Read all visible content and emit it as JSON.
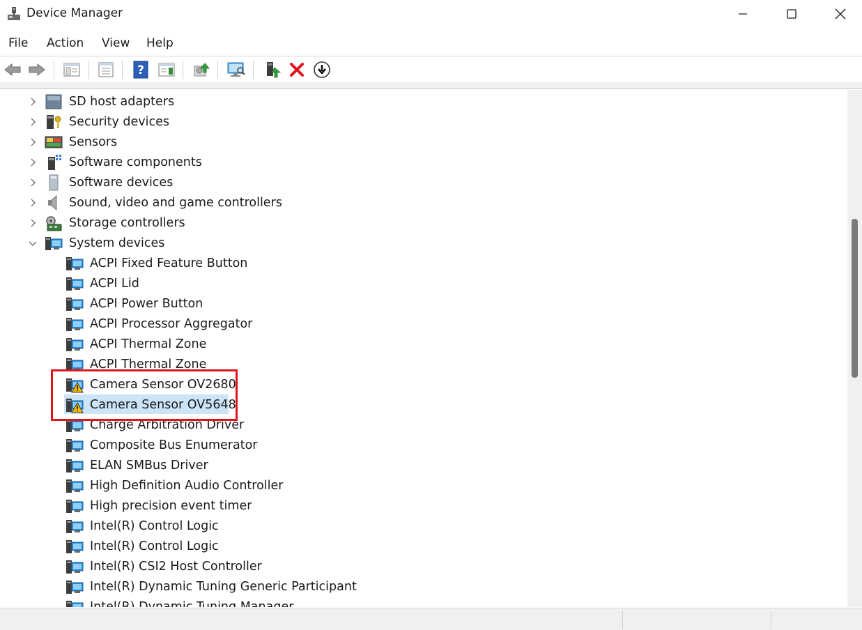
{
  "window": {
    "title": "Device Manager"
  },
  "menu": [
    "File",
    "Action",
    "View",
    "Help"
  ],
  "toolbar": {
    "buttons": [
      "back-icon",
      "forward-icon",
      "show-hide-console-tree-icon",
      "properties-icon",
      "help-icon",
      "action-pane-icon",
      "update-driver-icon",
      "scan-hardware-icon",
      "enable-device-icon",
      "uninstall-device-icon",
      "disable-device-icon"
    ]
  },
  "tree": {
    "categories": [
      {
        "label": "SD host adapters",
        "icon": "sd-host-icon",
        "expanded": false
      },
      {
        "label": "Security devices",
        "icon": "security-device-icon",
        "expanded": false
      },
      {
        "label": "Sensors",
        "icon": "sensor-icon",
        "expanded": false
      },
      {
        "label": "Software components",
        "icon": "software-component-icon",
        "expanded": false
      },
      {
        "label": "Software devices",
        "icon": "software-device-icon",
        "expanded": false
      },
      {
        "label": "Sound, video and game controllers",
        "icon": "speaker-icon",
        "expanded": false
      },
      {
        "label": "Storage controllers",
        "icon": "storage-controller-icon",
        "expanded": false
      },
      {
        "label": "System devices",
        "icon": "system-device-icon",
        "expanded": true
      }
    ],
    "system_devices": [
      {
        "label": "ACPI Fixed Feature Button",
        "warning": false,
        "selected": false
      },
      {
        "label": "ACPI Lid",
        "warning": false,
        "selected": false
      },
      {
        "label": "ACPI Power Button",
        "warning": false,
        "selected": false
      },
      {
        "label": "ACPI Processor Aggregator",
        "warning": false,
        "selected": false
      },
      {
        "label": "ACPI Thermal Zone",
        "warning": false,
        "selected": false
      },
      {
        "label": "ACPI Thermal Zone",
        "warning": false,
        "selected": false
      },
      {
        "label": "Camera Sensor OV2680",
        "warning": true,
        "selected": false
      },
      {
        "label": "Camera Sensor OV5648",
        "warning": true,
        "selected": true
      },
      {
        "label": "Charge Arbitration Driver",
        "warning": false,
        "selected": false
      },
      {
        "label": "Composite Bus Enumerator",
        "warning": false,
        "selected": false
      },
      {
        "label": "ELAN SMBus Driver",
        "warning": false,
        "selected": false
      },
      {
        "label": "High Definition Audio Controller",
        "warning": false,
        "selected": false
      },
      {
        "label": "High precision event timer",
        "warning": false,
        "selected": false
      },
      {
        "label": "Intel(R) Control Logic",
        "warning": false,
        "selected": false
      },
      {
        "label": "Intel(R) Control Logic",
        "warning": false,
        "selected": false
      },
      {
        "label": "Intel(R) CSI2 Host Controller",
        "warning": false,
        "selected": false
      },
      {
        "label": "Intel(R) Dynamic Tuning Generic Participant",
        "warning": false,
        "selected": false
      },
      {
        "label": "Intel(R) Dynamic Tuning Manager",
        "warning": false,
        "selected": false
      }
    ]
  },
  "colors": {
    "selection": "#cce4f7",
    "highlight_border": "#e0141c",
    "warning": "#f2b900"
  }
}
